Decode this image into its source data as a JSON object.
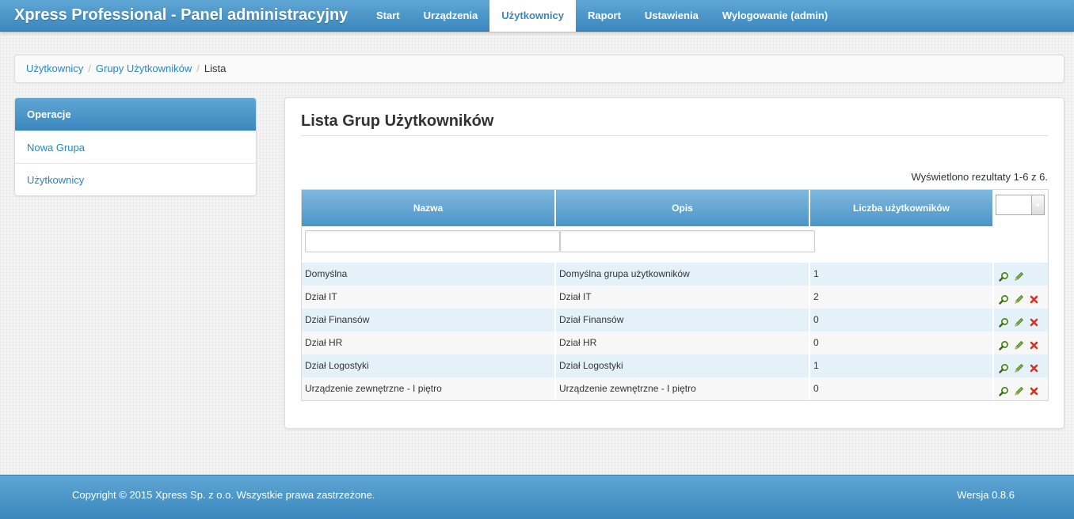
{
  "app": {
    "title": "Xpress Professional - Panel administracyjny"
  },
  "nav": [
    {
      "label": "Start",
      "active": false
    },
    {
      "label": "Urządzenia",
      "active": false
    },
    {
      "label": "Użytkownicy",
      "active": true
    },
    {
      "label": "Raport",
      "active": false
    },
    {
      "label": "Ustawienia",
      "active": false
    },
    {
      "label": "Wylogowanie (admin)",
      "active": false
    }
  ],
  "breadcrumb": {
    "items": [
      "Użytkownicy",
      "Grupy Użytkowników"
    ],
    "current": "Lista",
    "separator": "/"
  },
  "sidebar": {
    "title": "Operacje",
    "items": [
      "Nowa Grupa",
      "Użytkownicy"
    ]
  },
  "main": {
    "title": "Lista Grup Użytkowników",
    "summary": "Wyświetlono rezultaty 1-6 z 6.",
    "columns": [
      "Nazwa",
      "Opis",
      "Liczba użytkowników"
    ],
    "page_size": "20",
    "filters": {
      "name_value": "",
      "description_value": ""
    },
    "rows": [
      {
        "name": "Domyślna",
        "description": "Domyślna grupa użytkowników",
        "count": "1",
        "deletable": false
      },
      {
        "name": "Dział IT",
        "description": "Dział IT",
        "count": "2",
        "deletable": true
      },
      {
        "name": "Dział Finansów",
        "description": "Dział Finansów",
        "count": "0",
        "deletable": true
      },
      {
        "name": "Dział HR",
        "description": "Dział HR",
        "count": "0",
        "deletable": true
      },
      {
        "name": "Dział Logostyki",
        "description": "Dział Logostyki",
        "count": "1",
        "deletable": true
      },
      {
        "name": "Urządzenie zewnętrzne - I piętro",
        "description": "Urządzenie zewnętrzne - I piętro",
        "count": "0",
        "deletable": true
      }
    ],
    "row_actions": [
      "view-icon",
      "edit-icon",
      "delete-icon"
    ]
  },
  "footer": {
    "copyright": "Copyright © 2015 Xpress Sp. z o.o. Wszystkie prawa zastrzeżone.",
    "version": "Wersja 0.8.6"
  },
  "colors": {
    "accent": "#3b87bd",
    "link": "#2a86c2",
    "row_alt": "#e5f1f8",
    "delete": "#d9321f",
    "edit": "#6a9a2a"
  }
}
